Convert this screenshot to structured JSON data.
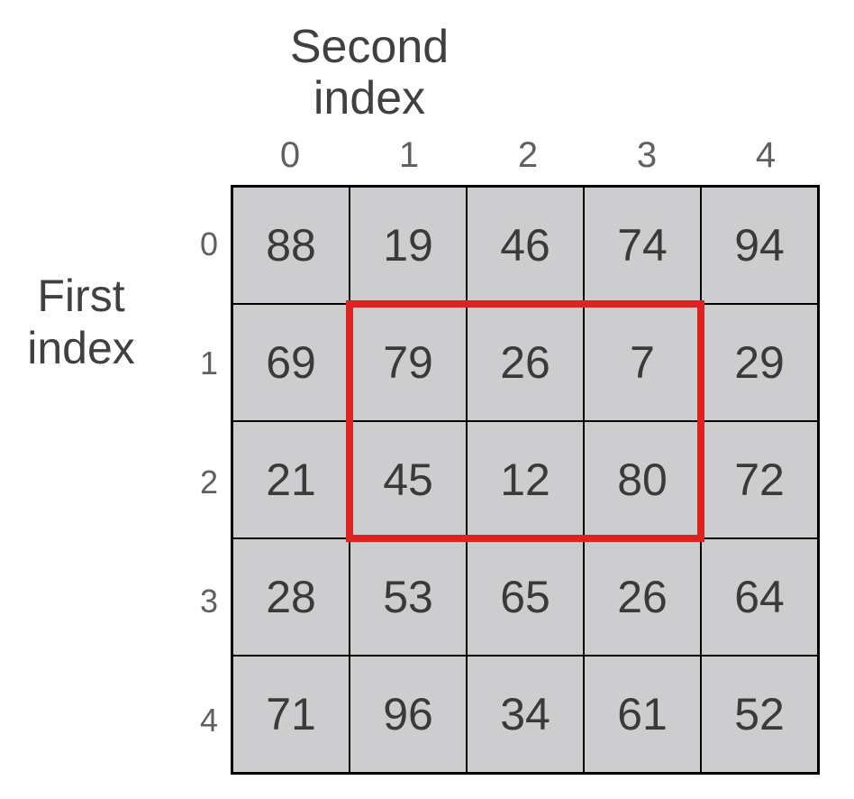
{
  "labels": {
    "second_line1": "Second",
    "second_line2": "index",
    "first_line1": "First",
    "first_line2": "index"
  },
  "col_headers": [
    "0",
    "1",
    "2",
    "3",
    "4"
  ],
  "row_headers": [
    "0",
    "1",
    "2",
    "3",
    "4"
  ],
  "grid": [
    [
      88,
      19,
      46,
      74,
      94
    ],
    [
      69,
      79,
      26,
      7,
      29
    ],
    [
      21,
      45,
      12,
      80,
      72
    ],
    [
      28,
      53,
      65,
      26,
      64
    ],
    [
      71,
      96,
      34,
      61,
      52
    ]
  ],
  "highlight": {
    "row_start": 1,
    "row_end": 2,
    "col_start": 1,
    "col_end": 3,
    "color": "#dd2222"
  },
  "chart_data": {
    "type": "table",
    "title": "2D array indexing diagram",
    "row_label": "First index",
    "col_label": "Second index",
    "row_indices": [
      0,
      1,
      2,
      3,
      4
    ],
    "col_indices": [
      0,
      1,
      2,
      3,
      4
    ],
    "values": [
      [
        88,
        19,
        46,
        74,
        94
      ],
      [
        69,
        79,
        26,
        7,
        29
      ],
      [
        21,
        45,
        12,
        80,
        72
      ],
      [
        28,
        53,
        65,
        26,
        64
      ],
      [
        71,
        96,
        34,
        61,
        52
      ]
    ],
    "highlighted_slice": {
      "rows": [
        1,
        2
      ],
      "cols": [
        1,
        2,
        3
      ]
    }
  }
}
